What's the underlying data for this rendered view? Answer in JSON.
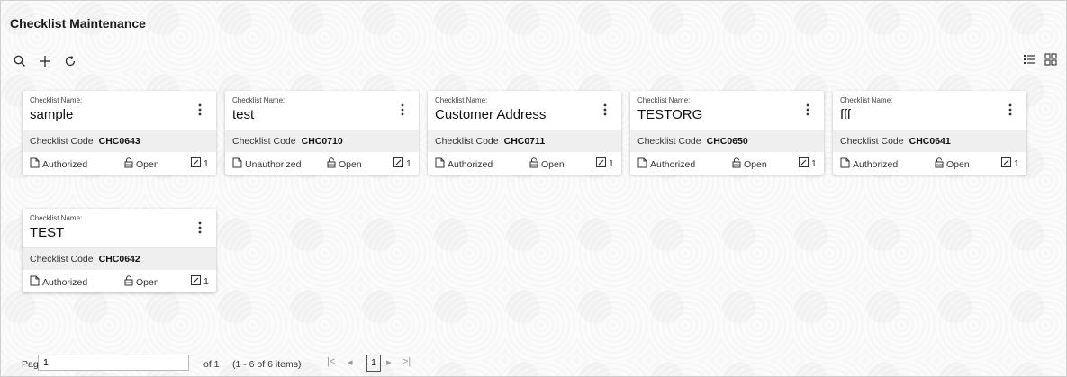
{
  "page": {
    "title": "Checklist Maintenance"
  },
  "toolbar": {
    "search_icon": "search-icon",
    "add_icon": "plus-icon",
    "refresh_icon": "refresh-icon"
  },
  "view": {
    "list_icon": "list-view-icon",
    "grid_icon": "grid-view-icon"
  },
  "cards": [
    {
      "caption": "Checklist Name:",
      "name": "sample",
      "code_label": "Checklist Code",
      "code": "CHC0643",
      "status": "Authorized",
      "lock": "Open",
      "edit_count": "1"
    },
    {
      "caption": "Checklist Name:",
      "name": "test",
      "code_label": "Checklist Code",
      "code": "CHC0710",
      "status": "Unauthorized",
      "lock": "Open",
      "edit_count": "1"
    },
    {
      "caption": "Checklist Name:",
      "name": "Customer Address",
      "code_label": "Checklist Code",
      "code": "CHC0711",
      "status": "Authorized",
      "lock": "Open",
      "edit_count": "1"
    },
    {
      "caption": "Checklist Name:",
      "name": "TESTORG",
      "code_label": "Checklist Code",
      "code": "CHC0650",
      "status": "Authorized",
      "lock": "Open",
      "edit_count": "1"
    },
    {
      "caption": "Checklist Name:",
      "name": "fff",
      "code_label": "Checklist Code",
      "code": "CHC0641",
      "status": "Authorized",
      "lock": "Open",
      "edit_count": "1"
    },
    {
      "caption": "Checklist Name:",
      "name": "TEST",
      "code_label": "Checklist Code",
      "code": "CHC0642",
      "status": "Authorized",
      "lock": "Open",
      "edit_count": "1"
    }
  ],
  "pager": {
    "label": "Page",
    "value": "1",
    "of": "of 1",
    "items": "(1 - 6 of 6 items)",
    "current": "1"
  }
}
